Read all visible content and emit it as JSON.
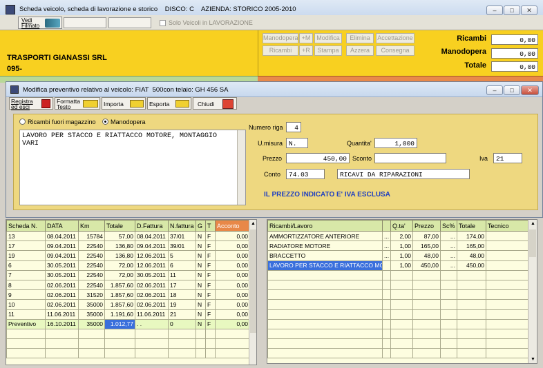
{
  "main": {
    "title": "Scheda veicolo, scheda di lavorazione e storico    DISCO: C    AZIENDA: STORICO 2005-2010",
    "vedi_filmato": "Vedi\nFilmato",
    "solo_veicoli": "Solo Veicoli in LAVORAZIONE",
    "company": "TRASPORTI GIANASSI SRL",
    "code": "095-",
    "buttons": {
      "manodopera": "Manodopera",
      "add_m": "+M",
      "modifica": "Modifica",
      "elimina": "Elimina",
      "accettazione": "Accettazione",
      "ricambi": "Ricambi",
      "add_r": "+R",
      "stampa": "Stampa",
      "azzera": "Azzera",
      "consegna": "Consegna"
    },
    "totals": {
      "ricambi_label": "Ricambi",
      "ricambi_value": "0,00",
      "manodopera_label": "Manodopera",
      "manodopera_value": "0,00",
      "totale_label": "Totale",
      "totale_value": "0,00"
    }
  },
  "dialog": {
    "title": "Modifica preventivo relativo al veicolo: FIAT  500con telaio: GH 456 SA",
    "toolbar": {
      "registra": "Registra\ned esci",
      "formatta": "Formatta\nTesto",
      "importa": "Importa",
      "esporta": "Esporta",
      "chiudi": "Chiudi"
    },
    "radio_ricambi": "Ricambi fuori magazzino",
    "radio_manodopera": "Manodopera",
    "description": "LAVORO PER STACCO E RIATTACCO MOTORE, MONTAGGIO VARI",
    "numero_riga_label": "Numero riga",
    "numero_riga": "4",
    "umisura_label": "U.misura",
    "umisura": "N.",
    "quantita_label": "Quantita'",
    "quantita": "1,000",
    "prezzo_label": "Prezzo",
    "prezzo": "450,00",
    "sconto_label": "Sconto",
    "sconto": "",
    "iva_label": "Iva",
    "iva": "21",
    "conto_label": "Conto",
    "conto": "74.03",
    "conto_desc": "RICAVI DA RIPARAZIONI",
    "note": "IL PREZZO INDICATO E' IVA ESCLUSA"
  },
  "left_table": {
    "headers": [
      "Scheda N.",
      "DATA",
      "Km",
      "Totale",
      "D.Fattura",
      "N.fattura",
      "G",
      "T",
      "Acconto"
    ],
    "rows": [
      [
        "13",
        "08.04.2011",
        "15784",
        "57,00",
        "08.04.2011",
        "37/01",
        "N",
        "F",
        "0,00"
      ],
      [
        "17",
        "09.04.2011",
        "22540",
        "136,80",
        "09.04.2011",
        "39/01",
        "N",
        "F",
        "0,00"
      ],
      [
        "19",
        "09.04.2011",
        "22540",
        "136,80",
        "12.06.2011",
        "5",
        "N",
        "F",
        "0,00"
      ],
      [
        "6",
        "30.05.2011",
        "22540",
        "72,00",
        "12.06.2011",
        "6",
        "N",
        "F",
        "0,00"
      ],
      [
        "7",
        "30.05.2011",
        "22540",
        "72,00",
        "30.05.2011",
        "11",
        "N",
        "F",
        "0,00"
      ],
      [
        "8",
        "02.06.2011",
        "22540",
        "1.857,60",
        "02.06.2011",
        "17",
        "N",
        "F",
        "0,00"
      ],
      [
        "9",
        "02.06.2011",
        "31520",
        "1.857,60",
        "02.06.2011",
        "18",
        "N",
        "F",
        "0,00"
      ],
      [
        "10",
        "02.06.2011",
        "35000",
        "1.857,60",
        "02.06.2011",
        "19",
        "N",
        "F",
        "0,00"
      ],
      [
        "11",
        "11.06.2011",
        "35000",
        "1.191,60",
        "11.06.2011",
        "21",
        "N",
        "F",
        "0,00"
      ],
      [
        "Preventivo",
        "16.10.2011",
        "35000",
        "1.012,77",
        ". .",
        "0",
        "N",
        "F",
        "0,00"
      ]
    ]
  },
  "right_table": {
    "headers": [
      "Ricambi/Lavoro",
      "Q.ta'",
      "Prezzo",
      "Sc%",
      "Totale",
      "Tecnico"
    ],
    "rows": [
      [
        "AMMORTIZZATORE ANTERIORE",
        "...",
        "2,00",
        "87,00",
        "...",
        "174,00",
        ""
      ],
      [
        "RADIATORE MOTORE",
        "...",
        "1,00",
        "165,00",
        "...",
        "165,00",
        ""
      ],
      [
        "BRACCETTO",
        "...",
        "1,00",
        "48,00",
        "...",
        "48,00",
        ""
      ],
      [
        "LAVORO PER STACCO E RIATTACCO MO...",
        "",
        "1,00",
        "450,00",
        "...",
        "450,00",
        ""
      ]
    ]
  },
  "icons": {
    "app": "app-icon",
    "film": "film-icon",
    "save": "save-icon",
    "close": "close-door-icon"
  },
  "colors": {
    "yellow": "#f8d020",
    "panel": "#eed880",
    "grid_header": "#d8e8a8",
    "grid_row": "#fdfde0",
    "selection": "#3a6fdc",
    "note": "#2040c0"
  }
}
